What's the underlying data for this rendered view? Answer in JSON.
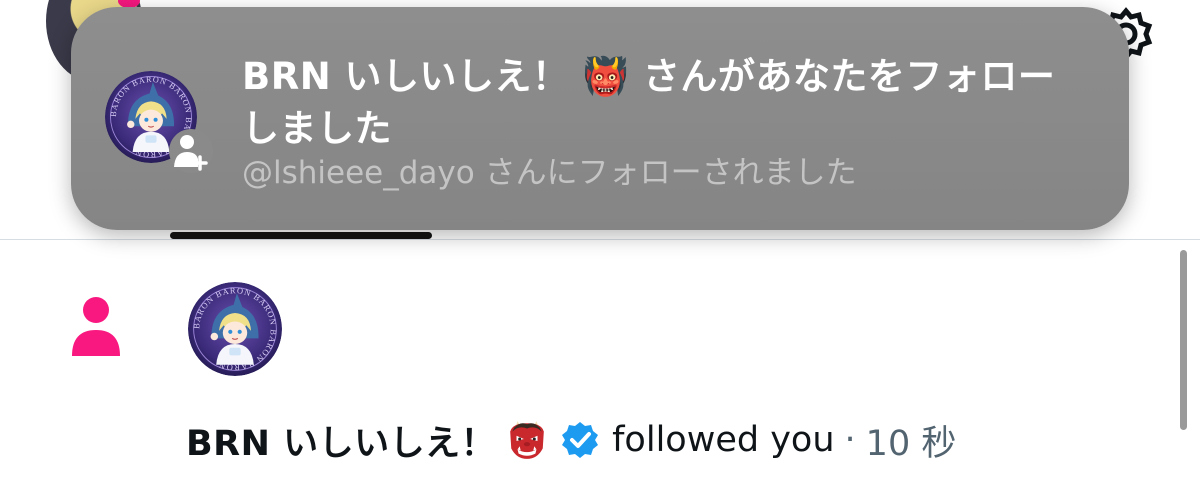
{
  "banner": {
    "title": "BRN いしいしえ！ 👹 さんがあなたをフォローしました",
    "subtitle": "@lshieee_dayo さんにフォローされました",
    "avatar_ring_text": "BARON BARON BARON",
    "badge_icon": "person-add-icon"
  },
  "notification": {
    "icon": "person-icon",
    "icon_color": "#f91880",
    "avatar_ring_text": "BARON BARON BARON",
    "name": "BRN いしいしえ！",
    "emoji": "oni-emoji-icon",
    "verified_color": "#1d9bf0",
    "action": "followed you",
    "separator": "·",
    "time": "10 秒"
  }
}
